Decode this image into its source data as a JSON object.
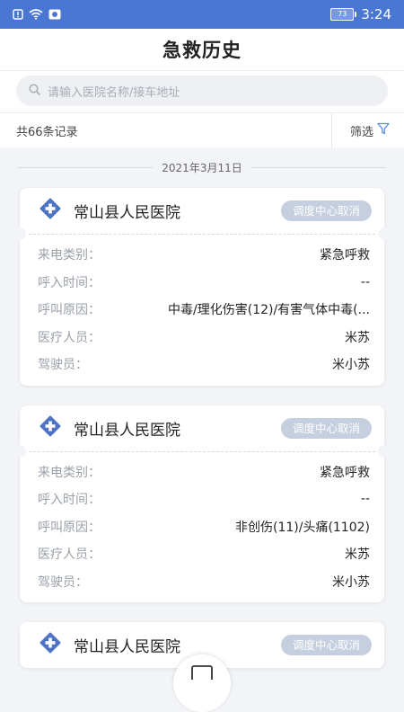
{
  "status_bar": {
    "time": "3:24",
    "battery": "73"
  },
  "header": {
    "title": "急救历史"
  },
  "search": {
    "placeholder": "请输入医院名称/接车地址"
  },
  "filter_bar": {
    "count": "共66条记录",
    "filter_label": "筛选"
  },
  "date_separator": "2021年3月11日",
  "records": [
    {
      "hospital": "常山县人民医院",
      "status": "调度中心取消",
      "fields": [
        {
          "label": "来电类别：",
          "value": "紧急呼救"
        },
        {
          "label": "呼入时间：",
          "value": "--"
        },
        {
          "label": "呼叫原因：",
          "value": "中毒/理化伤害(12)/有害气体中毒(..."
        },
        {
          "label": "医疗人员：",
          "value": "米苏"
        },
        {
          "label": "驾驶员：",
          "value": "米小苏"
        }
      ]
    },
    {
      "hospital": "常山县人民医院",
      "status": "调度中心取消",
      "fields": [
        {
          "label": "来电类别：",
          "value": "紧急呼救"
        },
        {
          "label": "呼入时间：",
          "value": "--"
        },
        {
          "label": "呼叫原因：",
          "value": "非创伤(11)/头痛(1102)"
        },
        {
          "label": "医疗人员：",
          "value": "米苏"
        },
        {
          "label": "驾驶员：",
          "value": "米小苏"
        }
      ]
    },
    {
      "hospital": "常山县人民医院",
      "status": "调度中心取消",
      "fields": []
    }
  ],
  "colors": {
    "status_bar": "#4a77d4",
    "badge": "#c6cfe0",
    "hospital_icon": "#4e72c4",
    "filter_icon": "#5a8de0"
  },
  "icons": {
    "hospital": "hospital-cross-icon",
    "search": "search-icon",
    "filter": "funnel-icon",
    "fab": "scan-icon"
  }
}
